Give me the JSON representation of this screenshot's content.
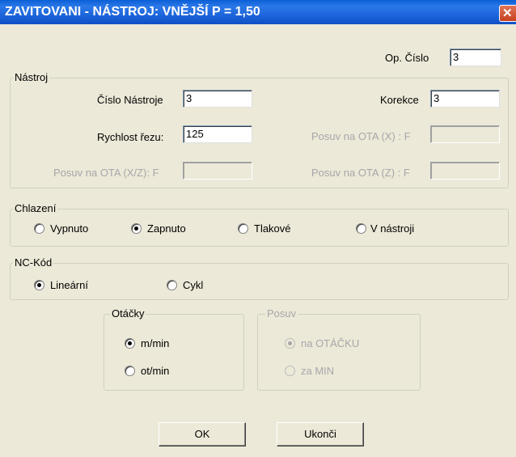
{
  "window": {
    "title": "ZAVITOVANI - NÁSTROJ: VNĚJŠÍ P = 1,50"
  },
  "op": {
    "label": "Op. Číslo",
    "value": "3"
  },
  "nastroj": {
    "legend": "Nástroj",
    "cislo_label": "Číslo Nástroje",
    "cislo_value": "3",
    "korekce_label": "Korekce",
    "korekce_value": "3",
    "rychlost_label": "Rychlost řezu:",
    "rychlost_value": "125",
    "posun_x_label": "Posuv na OTA (X) : F",
    "posun_xz_label": "Posuv na OTA (X/Z): F",
    "posun_z_label": "Posuv na OTA (Z) : F"
  },
  "chlazeni": {
    "legend": "Chlazení",
    "options": [
      "Vypnuto",
      "Zapnuto",
      "Tlakové",
      "V nástroji"
    ],
    "selected": "Zapnuto"
  },
  "nc": {
    "legend": "NC-Kód",
    "options": [
      "Lineární",
      "Cykl"
    ],
    "selected": "Lineární"
  },
  "otacky": {
    "legend": "Otáčky",
    "options": [
      "m/min",
      "ot/min"
    ],
    "selected": "m/min"
  },
  "posuv": {
    "legend": "Posuv",
    "options": [
      "na OTÁČKU",
      "za MIN"
    ],
    "selected": "na OTÁČKU"
  },
  "buttons": {
    "ok": "OK",
    "cancel": "Ukonči"
  }
}
